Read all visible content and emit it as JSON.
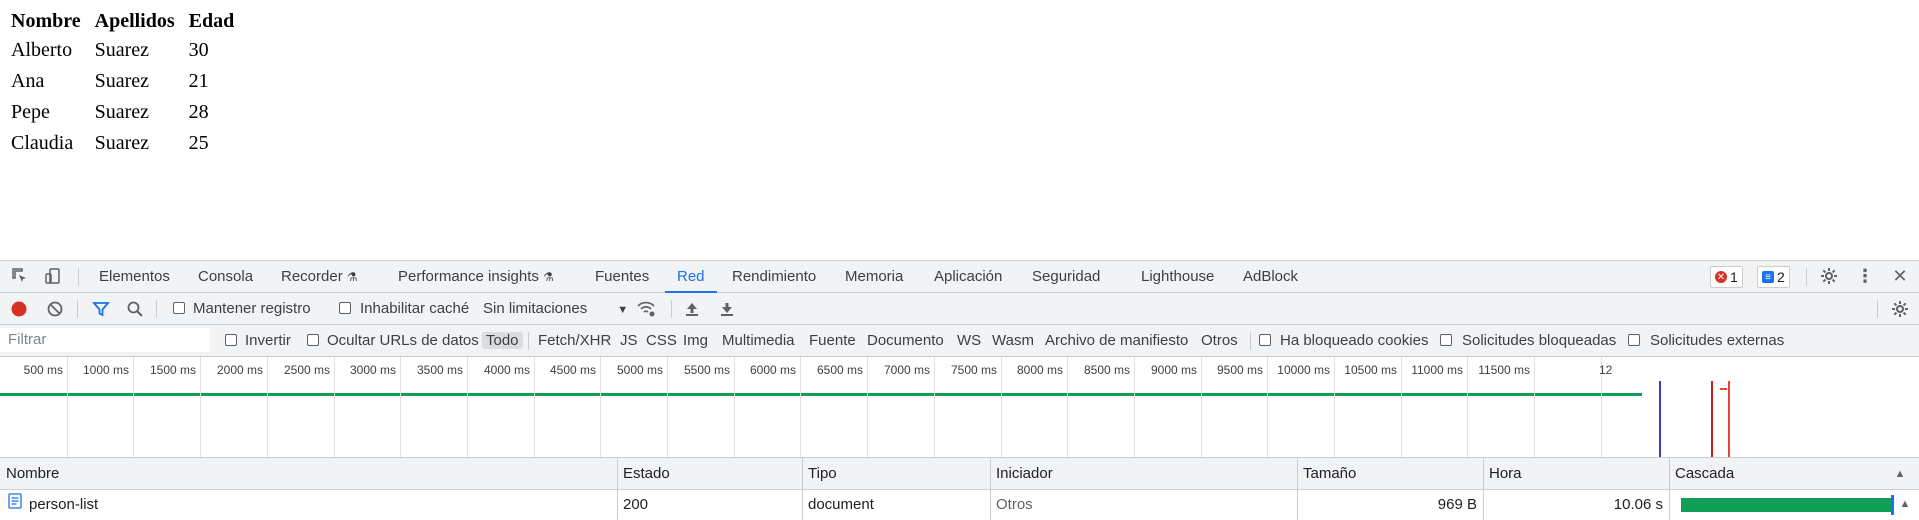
{
  "page": {
    "headers": [
      "Nombre",
      "Apellidos",
      "Edad"
    ],
    "rows": [
      [
        "Alberto",
        "Suarez",
        "30"
      ],
      [
        "Ana",
        "Suarez",
        "21"
      ],
      [
        "Pepe",
        "Suarez",
        "28"
      ],
      [
        "Claudia",
        "Suarez",
        "25"
      ]
    ]
  },
  "devtools": {
    "tabs": [
      "Elementos",
      "Consola",
      "Recorder",
      "Performance insights",
      "Fuentes",
      "Red",
      "Rendimiento",
      "Memoria",
      "Aplicación",
      "Seguridad",
      "Lighthouse",
      "AdBlock"
    ],
    "active_tab": "Red",
    "errors_count": "1",
    "messages_count": "2",
    "network_toolbar": {
      "preserve_log": "Mantener registro",
      "disable_cache": "Inhabilitar caché",
      "throttling": "Sin limitaciones"
    },
    "filter_bar": {
      "placeholder": "Filtrar",
      "invert": "Invertir",
      "hide_data_urls": "Ocultar URLs de datos",
      "types": [
        "Todo",
        "Fetch/XHR",
        "JS",
        "CSS",
        "Img",
        "Multimedia",
        "Fuente",
        "Documento",
        "WS",
        "Wasm",
        "Archivo de manifiesto",
        "Otros"
      ],
      "active_type": "Todo",
      "blocked_cookies": "Ha bloqueado cookies",
      "blocked_requests": "Solicitudes bloqueadas",
      "third_party": "Solicitudes externas"
    },
    "timeline_ticks": [
      "500 ms",
      "1000 ms",
      "1500 ms",
      "2000 ms",
      "2500 ms",
      "3000 ms",
      "3500 ms",
      "4000 ms",
      "4500 ms",
      "5000 ms",
      "5500 ms",
      "6000 ms",
      "6500 ms",
      "7000 ms",
      "7500 ms",
      "8000 ms",
      "8500 ms",
      "9000 ms",
      "9500 ms",
      "10000 ms",
      "10500 ms",
      "11000 ms",
      "11500 ms",
      "12"
    ],
    "columns": [
      "Nombre",
      "Estado",
      "Tipo",
      "Iniciador",
      "Tamaño",
      "Hora",
      "Cascada"
    ],
    "requests": [
      {
        "name": "person-list",
        "status": "200",
        "type": "document",
        "initiator": "Otros",
        "size": "969 B",
        "time": "10.06 s"
      }
    ],
    "colors": {
      "accent": "#1a73e8",
      "record": "#d93025",
      "waterfall_bar": "#0f9d58",
      "dom_content_loaded": "#1a1aff",
      "load_event": "#d93025"
    }
  }
}
